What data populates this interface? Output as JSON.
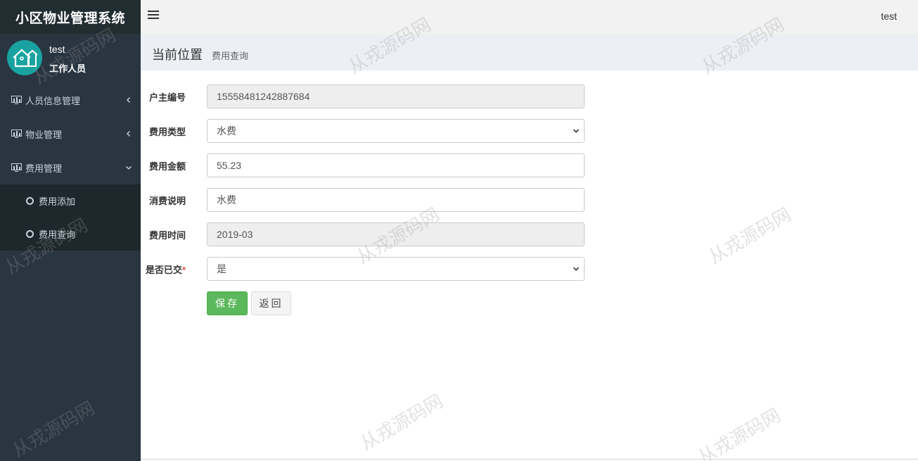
{
  "app": {
    "title": "小区物业管理系统"
  },
  "user": {
    "name": "test",
    "role": "工作人员"
  },
  "sidebar": {
    "items": [
      {
        "label": "人员信息管理"
      },
      {
        "label": "物业管理"
      },
      {
        "label": "费用管理"
      }
    ],
    "subitems": [
      {
        "label": "费用添加"
      },
      {
        "label": "费用查询"
      }
    ]
  },
  "topbar": {
    "user": "test"
  },
  "breadcrumb": {
    "title": "当前位置",
    "sub": "费用查询"
  },
  "form": {
    "owner_id": {
      "label": "户主编号",
      "value": "15558481242887684"
    },
    "fee_type": {
      "label": "费用类型",
      "value": "水费"
    },
    "amount": {
      "label": "费用金额",
      "value": "55.23"
    },
    "description": {
      "label": "消费说明",
      "value": "水费"
    },
    "fee_time": {
      "label": "费用时间",
      "value": "2019-03"
    },
    "paid": {
      "label": "是否已交",
      "required_mark": "*",
      "value": "是"
    }
  },
  "buttons": {
    "save": "保存",
    "back": "返回"
  },
  "watermark": "从戎源码网",
  "colors": {
    "sidebar": "#2a3542",
    "save": "#5cb85c",
    "avatar": "#19a3a0"
  }
}
